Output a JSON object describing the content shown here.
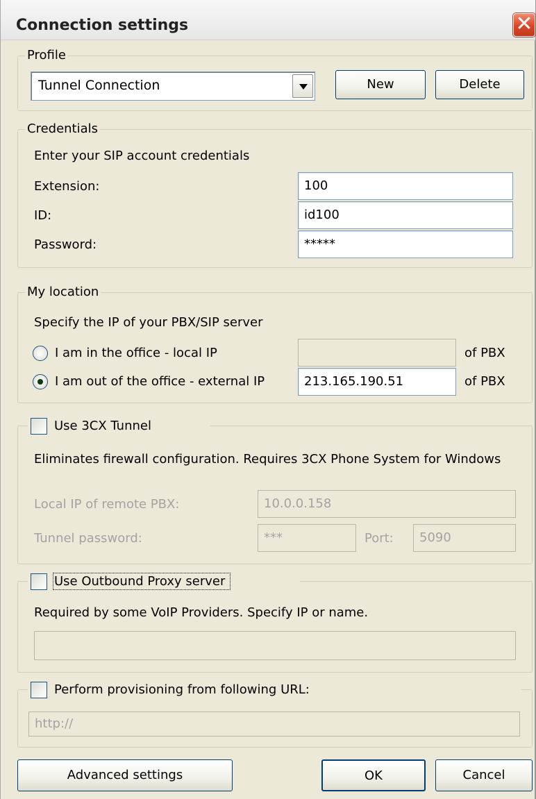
{
  "window": {
    "title": "Connection settings"
  },
  "profile": {
    "legend": "Profile",
    "selected": "Tunnel Connection",
    "new_label": "New",
    "delete_label": "Delete"
  },
  "credentials": {
    "legend": "Credentials",
    "hint": "Enter your SIP account credentials",
    "extension_label": "Extension:",
    "extension_value": "100",
    "id_label": "ID:",
    "id_value": "id100",
    "password_label": "Password:",
    "password_value": "*****"
  },
  "location": {
    "legend": "My location",
    "hint": "Specify the IP of your PBX/SIP server",
    "local_label": "I am in the office - local IP",
    "local_value": "",
    "local_suffix": "of PBX",
    "external_label": "I am out of the office - external IP",
    "external_value": "213.165.190.51",
    "external_suffix": "of PBX",
    "selected": "external"
  },
  "tunnel": {
    "legend": "Use 3CX Tunnel",
    "checked": false,
    "description": "Eliminates firewall configuration. Requires 3CX Phone System for Windows",
    "local_ip_label": "Local IP of remote PBX:",
    "local_ip_value": "10.0.0.158",
    "password_label": "Tunnel password:",
    "password_value": "***",
    "port_label": "Port:",
    "port_value": "5090"
  },
  "proxy": {
    "legend": "Use Outbound Proxy server",
    "checked": false,
    "description": "Required by some VoIP Providers. Specify IP or name.",
    "value": ""
  },
  "provisioning": {
    "legend": "Perform provisioning from following URL:",
    "checked": false,
    "url_value": "http://"
  },
  "footer": {
    "advanced_label": "Advanced settings",
    "ok_label": "OK",
    "cancel_label": "Cancel"
  },
  "icons": {
    "close": "close-icon",
    "dropdown": "chevron-down-icon"
  }
}
